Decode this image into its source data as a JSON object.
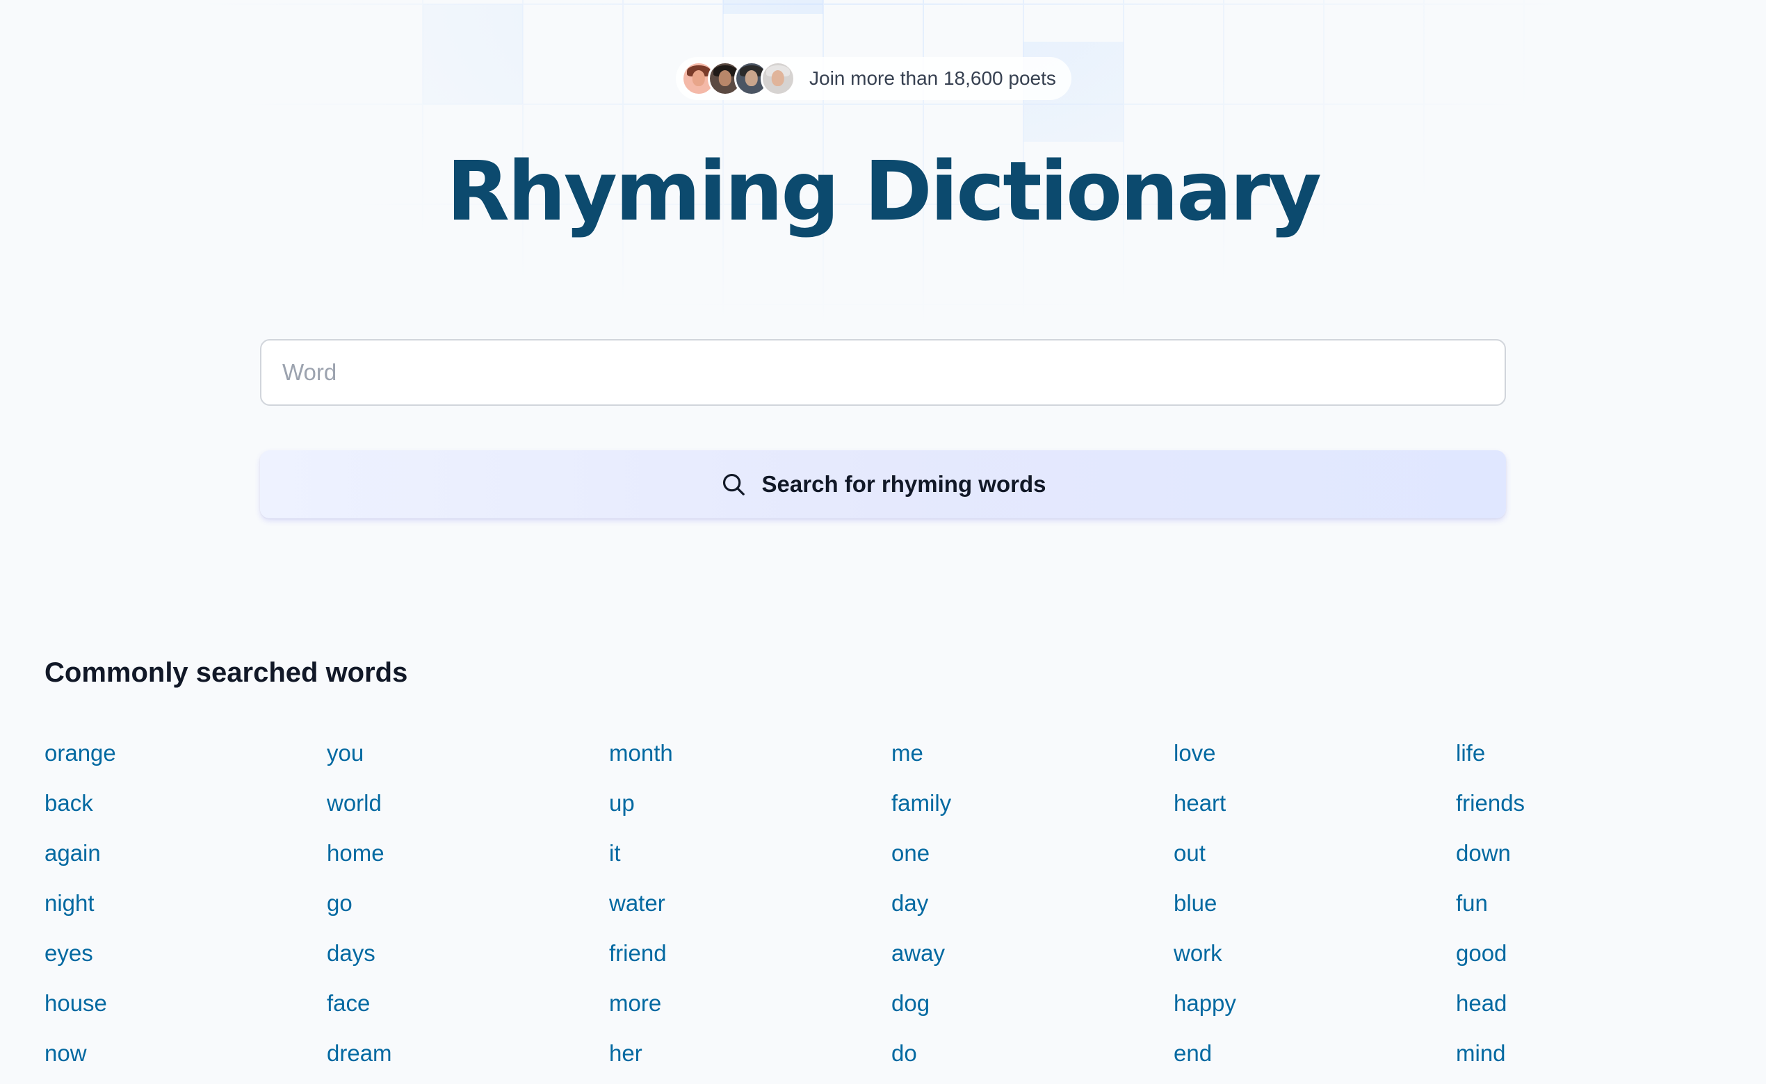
{
  "header": {
    "social_proof": "Join more than 18,600 poets",
    "avatars": [
      "avatar-1",
      "avatar-2",
      "avatar-3",
      "avatar-4"
    ]
  },
  "title": "Rhyming Dictionary",
  "search": {
    "placeholder": "Word",
    "value": "",
    "button_label": "Search for rhyming words",
    "button_icon": "search-icon"
  },
  "common": {
    "heading": "Commonly searched words",
    "words": [
      "orange",
      "you",
      "month",
      "me",
      "love",
      "life",
      "back",
      "world",
      "up",
      "family",
      "heart",
      "friends",
      "again",
      "home",
      "it",
      "one",
      "out",
      "down",
      "night",
      "go",
      "water",
      "day",
      "blue",
      "fun",
      "eyes",
      "days",
      "friend",
      "away",
      "work",
      "good",
      "house",
      "face",
      "more",
      "dog",
      "happy",
      "head",
      "now",
      "dream",
      "her",
      "do",
      "end",
      "mind"
    ]
  },
  "colors": {
    "title": "#0c4a6e",
    "link": "#0369a1",
    "button_bg": "#e5e9fd"
  }
}
